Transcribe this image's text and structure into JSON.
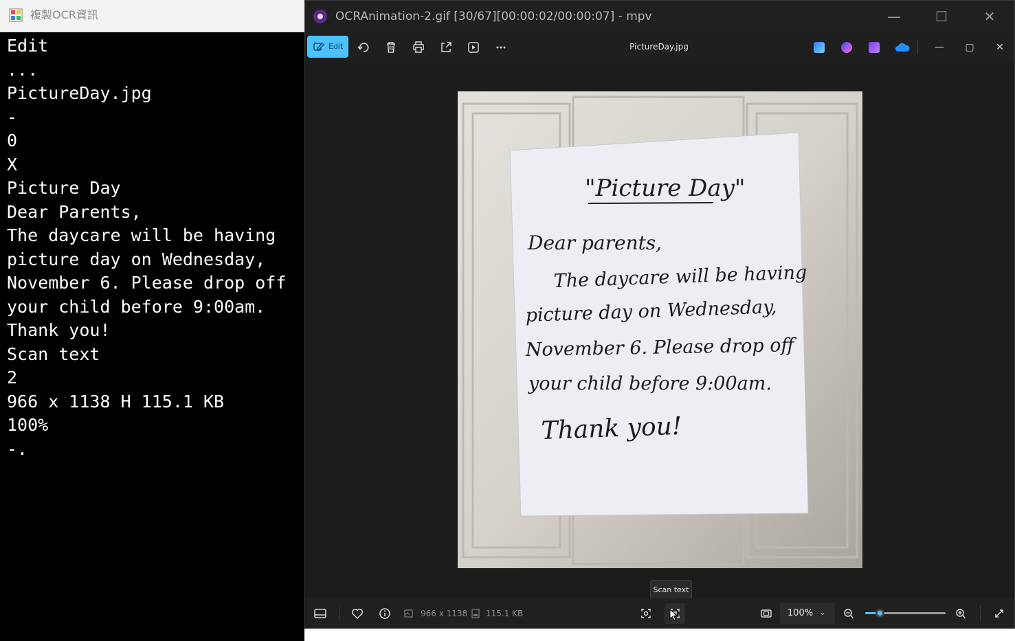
{
  "ocr_window": {
    "title": "複製OCR資訊",
    "lines": [
      "Edit",
      "...",
      "PictureDay.jpg",
      "-",
      "0",
      "X",
      "Picture Day",
      "Dear Parents,",
      "The daycare will be having",
      "picture day on Wednesday,",
      "November 6. Please drop off",
      "your child before 9:00am.",
      "Thank you!",
      "Scan text",
      "2",
      "966 x 1138 H 115.1 KB",
      "100%",
      "-."
    ]
  },
  "mpv_window": {
    "title": "OCRAnimation-2.gif [30/67][00:00:02/00:00:07] - mpv",
    "controls": {
      "minimize": "—",
      "maximize": "☐",
      "close": "✕"
    }
  },
  "photos_toolbar": {
    "edit_label": "Edit",
    "file_name": "PictureDay.jpg",
    "icons": [
      "edit-pen-icon",
      "rotate-icon",
      "delete-icon",
      "print-icon",
      "share-icon",
      "slideshow-icon",
      "more-icon"
    ],
    "app_icons": [
      "paint-app-icon",
      "designer-app-icon",
      "clipchamp-app-icon",
      "onedrive-icon"
    ],
    "window_controls": {
      "minimize": "—",
      "maximize": "▢",
      "close": "✕"
    }
  },
  "photo": {
    "note_lines": [
      "\"Picture Day\"",
      "Dear parents,",
      "The daycare will be having",
      "picture day on Wednesday,",
      "November 6. Please drop off",
      "your child before 9:00am.",
      "Thank you!"
    ],
    "colors": {
      "door": "#d9d5cf",
      "paper": "#eceef2",
      "ink": "#1c1c1c"
    }
  },
  "tooltip": {
    "text": "Scan text"
  },
  "bottom_bar": {
    "dimensions": "966 x 1138",
    "file_size": "115.1 KB",
    "zoom": "100%",
    "zoom_level_fraction": 0.18,
    "accent": "#4cc2ff"
  }
}
